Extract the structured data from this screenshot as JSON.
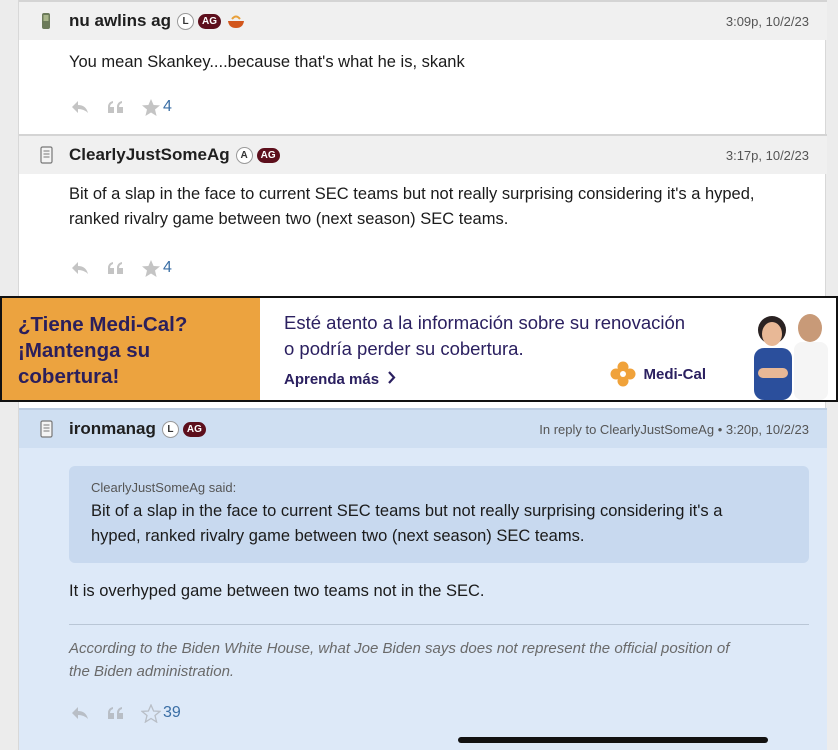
{
  "posts": [
    {
      "username": "nu awlins ag",
      "badge_letter": "L",
      "badge_ag": "AG",
      "timestamp": "3:09p, 10/2/23",
      "body": "You mean Skankey....because that's what he is, skank",
      "star_count": "4"
    },
    {
      "username": "ClearlyJustSomeAg",
      "badge_letter": "A",
      "badge_ag": "AG",
      "timestamp": "3:17p, 10/2/23",
      "body_line1": "Bit of a slap in the face to current SEC teams but not really surprising considering it's a hyped,",
      "body_line2": "ranked rivalry game between two (next season) SEC teams.",
      "star_count": "4"
    }
  ],
  "ad": {
    "left_line1": "¿Tiene Medi-Cal?",
    "left_line2": "¡Mantenga su",
    "left_line3": "cobertura!",
    "mid_line1": "Esté atento a la información sobre su renovación",
    "mid_line2": "o podría perder su cobertura.",
    "link": "Aprenda más",
    "brand": "Medi-Cal"
  },
  "reply": {
    "username": "ironmanag",
    "badge_letter": "L",
    "badge_ag": "AG",
    "reply_meta": "In reply to ClearlyJustSomeAg • 3:20p, 10/2/23",
    "quote_author": "ClearlyJustSomeAg said:",
    "quote_line1": "Bit of a slap in the face to current SEC teams but not really surprising considering it's a",
    "quote_line2": "hyped, ranked rivalry game between two (next season) SEC teams.",
    "body": "It is overhyped game between two teams not in the SEC.",
    "sig_line1": "According to the Biden White House, what Joe Biden says does not represent the official position of",
    "sig_line2": "the Biden administration.",
    "star_count": "39"
  },
  "colors": {
    "ag_badge": "#5d0f1c",
    "star_count": "#3a6ea5",
    "ad_orange": "#eca33f",
    "ad_text": "#2b2060",
    "reply_bg": "#dde9f8"
  }
}
